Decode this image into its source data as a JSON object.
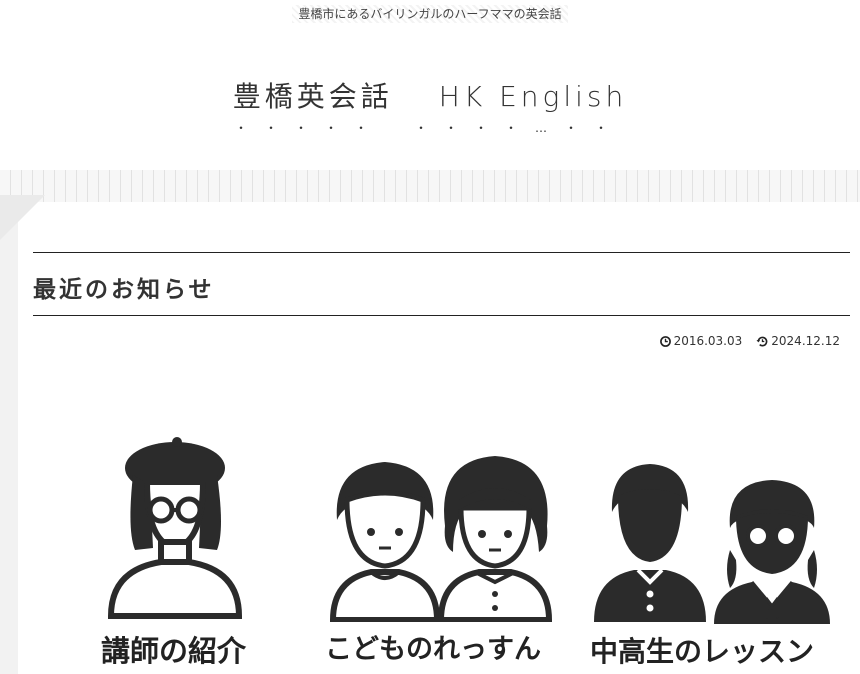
{
  "header": {
    "tagline": "豊橋市にあるバイリンガルのハーフママの英会話",
    "title_jp": "豊橋英会話",
    "title_en": "HK English",
    "dots": "・・・・・　・・・・…・・"
  },
  "post": {
    "heading": "最近のお知らせ",
    "published": "2016.03.03",
    "updated": "2024.12.12"
  },
  "illustrations": [
    {
      "label": "講師の紹介",
      "icon": "teacher-beret-icon"
    },
    {
      "label": "こどものれっすん",
      "icon": "children-icon"
    },
    {
      "label": "中高生のレッスン",
      "icon": "students-icon"
    }
  ],
  "colors": {
    "ink": "#222222",
    "rule": "#222222",
    "stripe": "#f7f7f7"
  }
}
